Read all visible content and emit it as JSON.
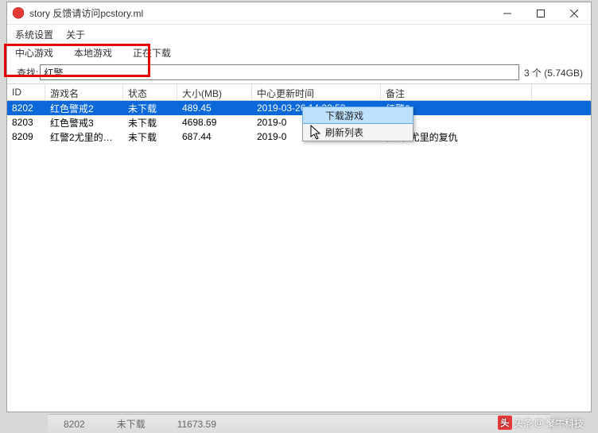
{
  "window": {
    "title": "story 反馈请访问pcstory.ml"
  },
  "menu": {
    "settings": "系统设置",
    "about": "关于"
  },
  "tabs": {
    "t1": "中心游戏",
    "t2": "本地游戏",
    "t3": "正在下载"
  },
  "search": {
    "label": "查找:",
    "value": "红警",
    "count": "3 个 (5.74GB)"
  },
  "headers": {
    "id": "ID",
    "name": "游戏名",
    "status": "状态",
    "size": "大小(MB)",
    "date": "中心更新时间",
    "remark": "备注"
  },
  "rows": [
    {
      "id": "8202",
      "name": "红色警戒2",
      "status": "未下载",
      "size": "489.45",
      "date": "2019-03-26 14:33:53",
      "remark": "红警2"
    },
    {
      "id": "8203",
      "name": "红色警戒3",
      "status": "未下载",
      "size": "4698.69",
      "date": "2019-0",
      "remark": ""
    },
    {
      "id": "8209",
      "name": "红警2尤里的…",
      "status": "未下载",
      "size": "687.44",
      "date": "2019-0",
      "remark": "警戒2尤里的复仇"
    }
  ],
  "context_menu": {
    "download": "下载游戏",
    "refresh": "刷新列表"
  },
  "watermark": {
    "prefix": "头条",
    "at": "@",
    "name": "聚牛科技"
  },
  "bottom": {
    "a": "8202",
    "b": "未下载",
    "c": "11673.59"
  }
}
